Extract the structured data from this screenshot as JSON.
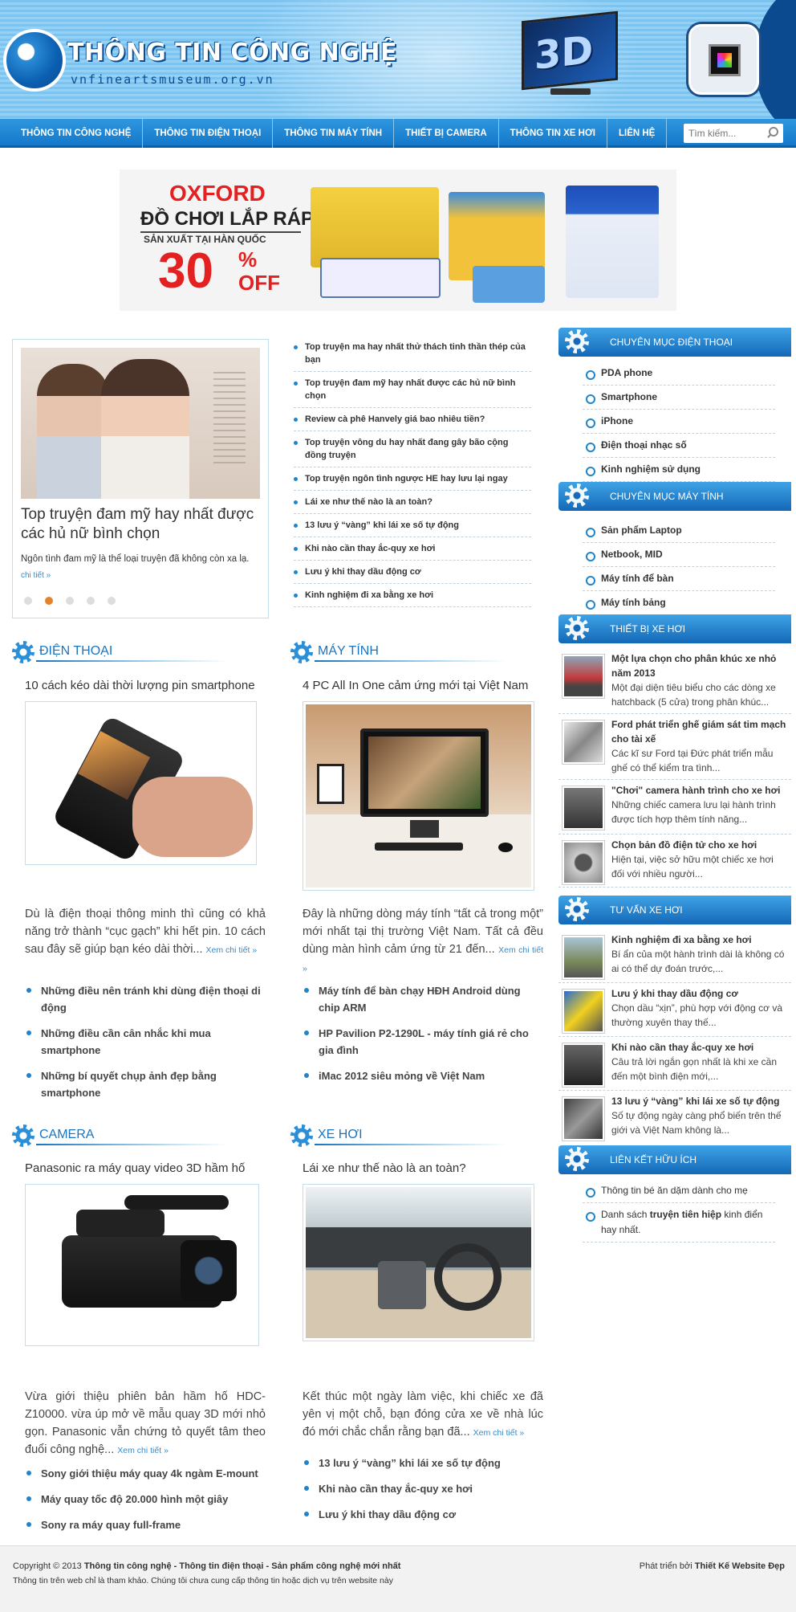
{
  "header": {
    "logo_title": "THÔNG TIN CÔNG NGHỆ",
    "logo_subtitle": "vnfineartsmuseum.org.vn",
    "tv_text": "3D"
  },
  "nav": {
    "items": [
      "THÔNG TIN CÔNG NGHỆ",
      "THÔNG TIN ĐIỆN THOẠI",
      "THÔNG TIN MÁY TÍNH",
      "THIẾT BỊ CAMERA",
      "THÔNG TIN XE HƠI",
      "LIÊN HỆ"
    ],
    "search_placeholder": "Tìm kiếm..."
  },
  "banner": {
    "brand": "OXFORD",
    "line1": "ĐỒ CHƠI LẮP RÁP",
    "line2": "SẢN XUẤT TẠI HÀN QUỐC",
    "discount": "30",
    "pct": "%",
    "off": "OFF"
  },
  "slider": {
    "title": "Top truyện đam mỹ hay nhất được các hủ nữ bình chọn",
    "desc": "Ngôn tình đam mỹ là thể loại truyện đã không còn xa lạ.",
    "more": "chi tiết »",
    "active_dot": 2,
    "dot_count": 5
  },
  "top_list": [
    "Top truyện ma hay nhất thử thách tinh thần thép của bạn",
    "Top truyện đam mỹ hay nhất được các hủ nữ bình chọn",
    "Review cà phê Hanvely giá bao nhiêu tiền?",
    "Top truyện vông du hay nhất đang gây bão cộng đồng truyện",
    "Top truyện ngôn tình ngược HE hay lưu lại ngay",
    "Lái xe như thế nào là an toàn?",
    "13 lưu ý “vàng” khi lái xe số tự động",
    "Khi nào cần thay ắc-quy xe hơi",
    "Lưu ý khi thay dầu động cơ",
    "Kinh nghiệm đi xa bằng xe hơi"
  ],
  "sections": {
    "dien_thoai": {
      "label": "ĐIỆN THOẠI",
      "title": "10 cách kéo dài thời lượng pin smartphone",
      "desc": "Dù là điện thoại thông minh thì cũng có khả năng trở thành “cục gạch” khi hết pin. 10 cách sau đây sẽ giúp bạn kéo dài thời...",
      "more": "Xem chi tiết »",
      "related": [
        "Những điều nên tránh khi dùng điện thoại di động",
        "Những điều cần cân nhắc khi mua smartphone",
        "Những bí quyết chụp ảnh đẹp bằng smartphone"
      ]
    },
    "may_tinh": {
      "label": "MÁY TÍNH",
      "title": "4 PC All In One cảm ứng mới tại Việt Nam",
      "desc": "Đây là những dòng máy tính “tất cả trong một” mới nhất tại thị trường Việt Nam. Tất cả đều dùng màn hình cảm ứng từ 21 đến...",
      "more": "Xem chi tiết »",
      "related": [
        "Máy tính để bàn chạy HĐH Android dùng chip ARM",
        "HP Pavilion P2-1290L - máy tính giá rẻ cho gia đình",
        "iMac 2012 siêu mỏng về Việt Nam"
      ]
    },
    "camera": {
      "label": "CAMERA",
      "title": "Panasonic ra máy quay video 3D hầm hố",
      "desc": "Vừa giới thiệu phiên bản hầm hố HDC-Z10000. vừa úp mở về mẫu quay 3D mới nhỏ gọn. Panasonic vẫn chứng tỏ quyết tâm theo đuổi công nghệ...",
      "more": "Xem chi tiết »",
      "related": [
        "Sony giới thiệu máy quay 4k ngàm E-mount",
        "Máy quay tốc độ 20.000 hình một giây",
        "Sony ra máy quay full-frame"
      ]
    },
    "xe_hoi": {
      "label": "XE HƠI",
      "title": "Lái xe như thế nào là an toàn?",
      "desc": "Kết thúc một ngày làm việc, khi chiếc xe đã yên vị một chỗ, bạn đóng cửa xe về nhà lúc đó mới chắc chắn rằng bạn đã...",
      "more": "Xem chi tiết »",
      "related": [
        "13 lưu ý “vàng” khi lái xe số tự động",
        "Khi nào cần thay ắc-quy xe hơi",
        "Lưu ý khi thay dầu động cơ"
      ]
    }
  },
  "sidebar": {
    "phone_cat": {
      "title": "CHUYÊN MỤC ĐIỆN THOẠI",
      "items": [
        "PDA phone",
        "Smartphone",
        "iPhone",
        "Điện thoại nhạc số",
        "Kinh nghiệm sử dụng"
      ]
    },
    "pc_cat": {
      "title": "CHUYÊN MỤC MÁY TÍNH",
      "items": [
        "Sản phẩm Laptop",
        "Netbook, MID",
        "Máy tính để bàn",
        "Máy tính bảng"
      ]
    },
    "car_devices": {
      "title": "THIẾT BỊ XE HƠI",
      "items": [
        {
          "title": "Một lựa chọn cho phân khúc xe nhỏ năm 2013",
          "desc": "Một đại diện tiêu biểu cho các dòng xe hatchback (5 cửa) trong phân khúc..."
        },
        {
          "title": "Ford phát triển ghế giám sát tim mạch cho tài xế",
          "desc": "Các kĩ sư Ford tại Đức phát triển mẫu ghế có thể kiểm tra tình..."
        },
        {
          "title": "\"Chơi\" camera hành trình cho xe hơi",
          "desc": "Những chiếc camera lưu lại hành trình được tích hợp thêm tính năng..."
        },
        {
          "title": "Chọn bản đồ điện tử cho xe hơi",
          "desc": "Hiện tại, việc sở hữu một chiếc xe hơi đối với nhiều người..."
        }
      ]
    },
    "car_advice": {
      "title": "TƯ VẤN XE HƠI",
      "items": [
        {
          "title": "Kinh nghiệm đi xa bằng xe hơi",
          "desc": "Bí ẩn của một hành trình dài là không có ai có thể dự đoán trước,..."
        },
        {
          "title": "Lưu ý khi thay dầu động cơ",
          "desc": "Chọn dầu “xịn”, phù hợp với động cơ và thường xuyên thay thế..."
        },
        {
          "title": "Khi nào cần thay ắc-quy xe hơi",
          "desc": "Câu trả lời ngắn gọn nhất là khi xe cần đến một bình điện mới,..."
        },
        {
          "title": "13 lưu ý “vàng” khi lái xe số tự động",
          "desc": "Số tự động ngày càng phổ biến trên thế giới và Việt Nam không là..."
        }
      ]
    },
    "links": {
      "title": "LIÊN KẾT HỮU ÍCH",
      "item1": "Thông tin bé ăn dặm dành cho mẹ",
      "item2_pre": "Danh sách ",
      "item2_bold": "truyện tiên hiệp",
      "item2_post": " kinh điển hay nhất."
    }
  },
  "footer": {
    "copyright_pre": "Copyright © 2013 ",
    "copyright_bold": "Thông tin công nghệ - Thông tin điện thoại - Sản phẩm công nghệ mới nhất",
    "disclaimer": "Thông tin trên web chỉ là tham khảo. Chúng tôi chưa cung cấp thông tin hoặc dịch vụ trên website này",
    "dev_pre": "Phát triển bởi ",
    "dev_bold": "Thiết Kế Website Đẹp"
  }
}
